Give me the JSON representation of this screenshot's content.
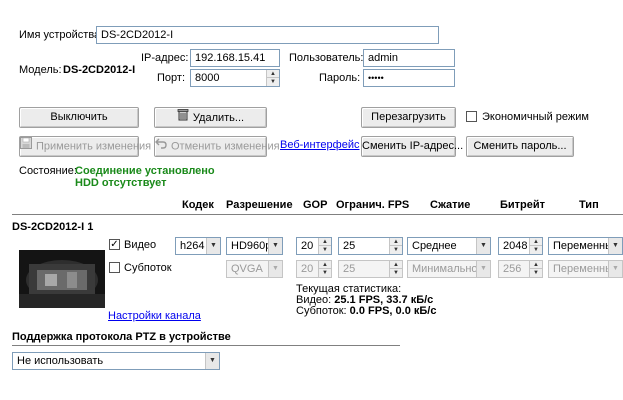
{
  "device": {
    "name_label": "Имя устройства:",
    "name_value": "DS-2CD2012-I",
    "model_label": "Модель:",
    "model_value": "DS-2CD2012-I",
    "ip_label": "IP-адрес:",
    "ip_value": "192.168.15.41",
    "port_label": "Порт:",
    "port_value": "8000",
    "user_label": "Пользователь:",
    "user_value": "admin",
    "password_label": "Пароль:",
    "password_value": "•••••"
  },
  "buttons": {
    "disconnect": "Выключить",
    "delete": "Удалить...",
    "reboot": "Перезагрузить",
    "apply": "Применить изменения",
    "cancel": "Отменить изменения",
    "web": "Веб-интерфейс",
    "change_ip": "Сменить IP-адрес...",
    "change_password": "Сменить пароль..."
  },
  "eco_mode_label": "Экономичный режим",
  "status": {
    "label": "Состояние:",
    "line1": "Соединение установлено",
    "line2": "HDD отсутствует"
  },
  "table": {
    "headers": {
      "codec": "Кодек",
      "resolution": "Разрешение",
      "gop": "GOP",
      "fps": "Огранич. FPS",
      "compression": "Сжатие",
      "bitrate": "Битрейт",
      "type": "Тип"
    },
    "channel_name": "DS-2CD2012-I 1",
    "video": {
      "label": "Видео",
      "checked": true,
      "codec": "h264",
      "resolution": "HD960p",
      "gop": "20",
      "fps": "25",
      "compression": "Среднее",
      "bitrate": "2048",
      "type": "Переменный"
    },
    "substream": {
      "label": "Субпоток",
      "checked": false,
      "resolution": "QVGA",
      "gop": "20",
      "fps": "25",
      "compression": "Минимальное",
      "bitrate": "256",
      "type": "Переменный"
    },
    "channel_settings": "Настройки канала",
    "stats": {
      "title": "Текущая статистика:",
      "video_label": "Видео:",
      "video_value": "25.1 FPS, 33.7 кБ/с",
      "sub_label": "Субпоток:",
      "sub_value": "0.0 FPS, 0.0 кБ/с"
    }
  },
  "ptz": {
    "title": "Поддержка протокола PTZ в устройстве",
    "selected": "Не использовать"
  }
}
